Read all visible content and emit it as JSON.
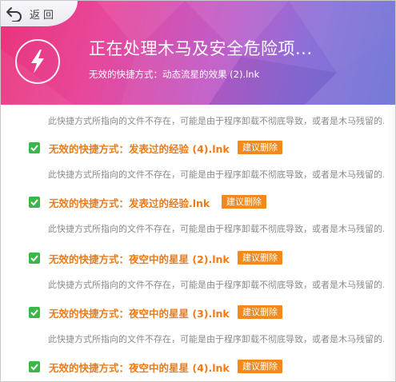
{
  "header": {
    "back_label": "返回",
    "title": "正在处理木马及安全危险项...",
    "subtitle": "无效的快捷方式：动态流星的效果 (2).lnk"
  },
  "description": "此快捷方式所指向的文件不存在，可能是由于程序卸载不彻底导致，或者是木马残留的...",
  "items": [
    {
      "name": "无效的快捷方式：发表过的经验 (4).lnk",
      "delete_label": "建议删除",
      "checked": true
    },
    {
      "name": "无效的快捷方式：发表过的经验.lnk",
      "delete_label": "建议删除",
      "checked": true
    },
    {
      "name": "无效的快捷方式：夜空中的星星 (2).lnk",
      "delete_label": "建议删除",
      "checked": true
    },
    {
      "name": "无效的快捷方式：夜空中的星星 (3).lnk",
      "delete_label": "建议删除",
      "checked": true
    },
    {
      "name": "无效的快捷方式：夜空中的星星 (4).lnk",
      "delete_label": "建议删除",
      "checked": true
    }
  ],
  "colors": {
    "accent_orange": "#f07a15",
    "delete_button": "#f08a1e",
    "checkbox_green": "#3ab64a",
    "header_pink": "#e8347a",
    "header_purple": "#8d6fd8"
  },
  "icons": {
    "back": "back-arrow-icon",
    "logo": "lightning-bolt-icon",
    "check": "checkmark-icon"
  }
}
